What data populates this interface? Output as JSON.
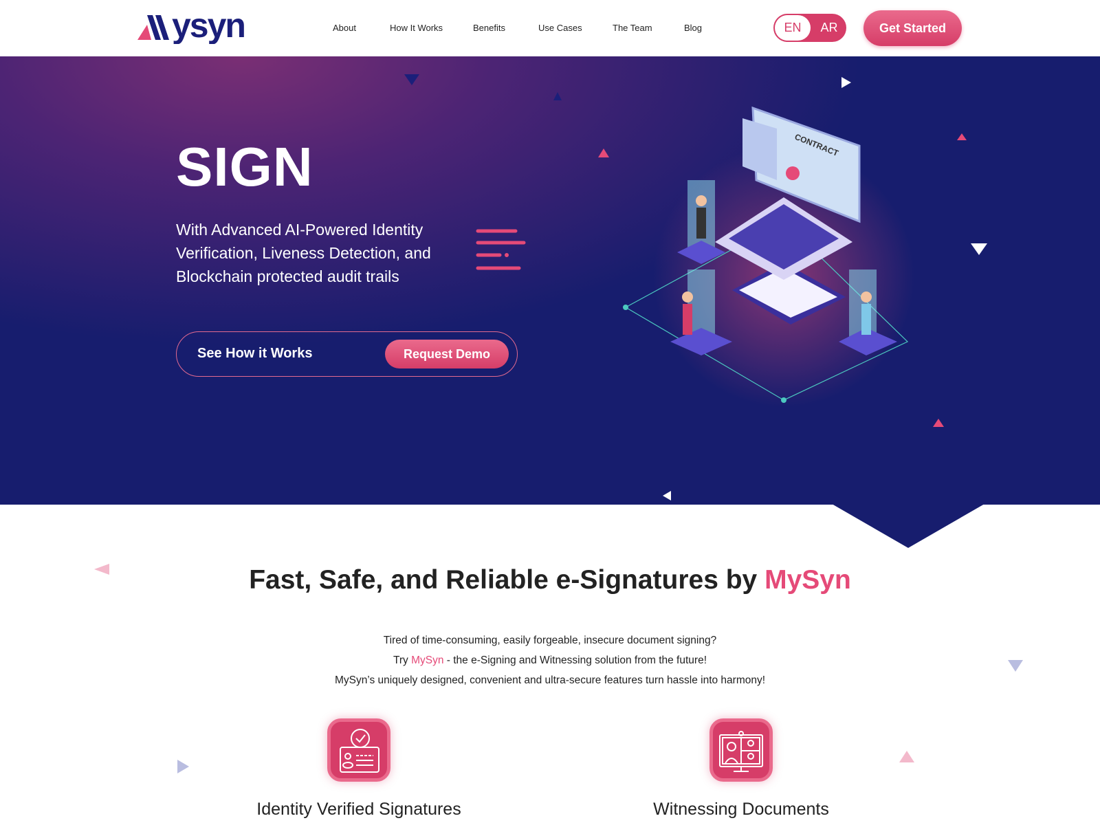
{
  "nav": {
    "logo": "mysyn",
    "items": [
      "About",
      "How It Works",
      "Benefits",
      "Use Cases",
      "The Team",
      "Blog"
    ],
    "lang": {
      "en": "EN",
      "ar": "AR",
      "selected": "EN"
    },
    "get_started": "Get Started"
  },
  "hero": {
    "title": "SIGN",
    "subtitle": "With Advanced AI-Powered Identity Verification, Liveness Detection, and Blockchain protected audit trails",
    "see_how": "See How it Works",
    "request_demo": "Request Demo",
    "illustration_label": "CONTRACT"
  },
  "intro": {
    "heading_prefix": "Fast, Safe, and Reliable e-Signatures by ",
    "heading_brand": "MySyn",
    "line1": "Tired of time-consuming, easily forgeable, insecure document signing?",
    "line2_prefix": "Try ",
    "line2_brand": "MySyn",
    "line2_suffix": " - the e-Signing and Witnessing solution from the future!",
    "line3": "MySyn’s uniquely designed, convenient and ultra-secure features turn hassle into harmony!"
  },
  "features": [
    {
      "title": "Identity Verified Signatures",
      "icon": "id-card-check-icon"
    },
    {
      "title": "Witnessing Documents",
      "icon": "video-call-icon"
    }
  ],
  "colors": {
    "accent": "#d63d68",
    "navy": "#171d6e",
    "purple": "#7a2f74"
  }
}
